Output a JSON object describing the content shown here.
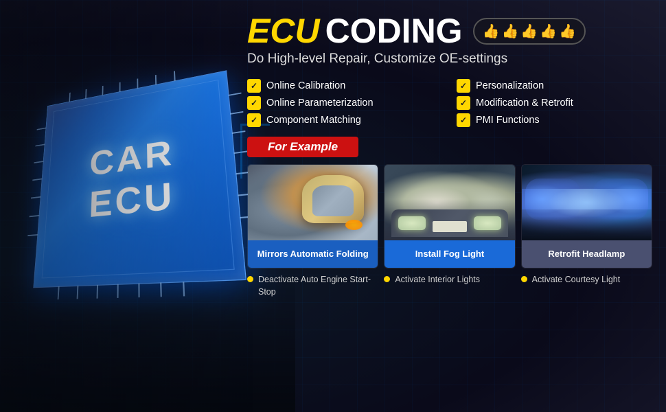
{
  "background": {
    "color1": "#0a0a1a",
    "color2": "#1a1a2e"
  },
  "header": {
    "ecu_label": "ECU",
    "coding_label": "CODING",
    "thumbs": [
      "👍",
      "👍",
      "👍",
      "👍",
      "👍"
    ],
    "subtitle": "Do High-level Repair, Customize OE-settings"
  },
  "chip": {
    "line1": "CAR",
    "line2": "ECU"
  },
  "features": [
    {
      "label": "Online Calibration"
    },
    {
      "label": "Personalization"
    },
    {
      "label": "Online Parameterization"
    },
    {
      "label": "Modification & Retrofit"
    },
    {
      "label": "Component Matching"
    },
    {
      "label": "PMI Functions"
    }
  ],
  "for_example": {
    "label": "For Example"
  },
  "example_cards": [
    {
      "id": "mirror",
      "caption": "Mirrors Automatic Folding",
      "caption_style": "blue"
    },
    {
      "id": "fog",
      "caption": "Install Fog Light",
      "caption_style": "bright-blue"
    },
    {
      "id": "headlamp",
      "caption": "Retrofit Headlamp",
      "caption_style": "slate"
    }
  ],
  "bottom_bullets": [
    {
      "text": "Deactivate Auto Engine Start-Stop"
    },
    {
      "text": "Activate Interior Lights"
    },
    {
      "text": "Activate Courtesy Light"
    }
  ]
}
